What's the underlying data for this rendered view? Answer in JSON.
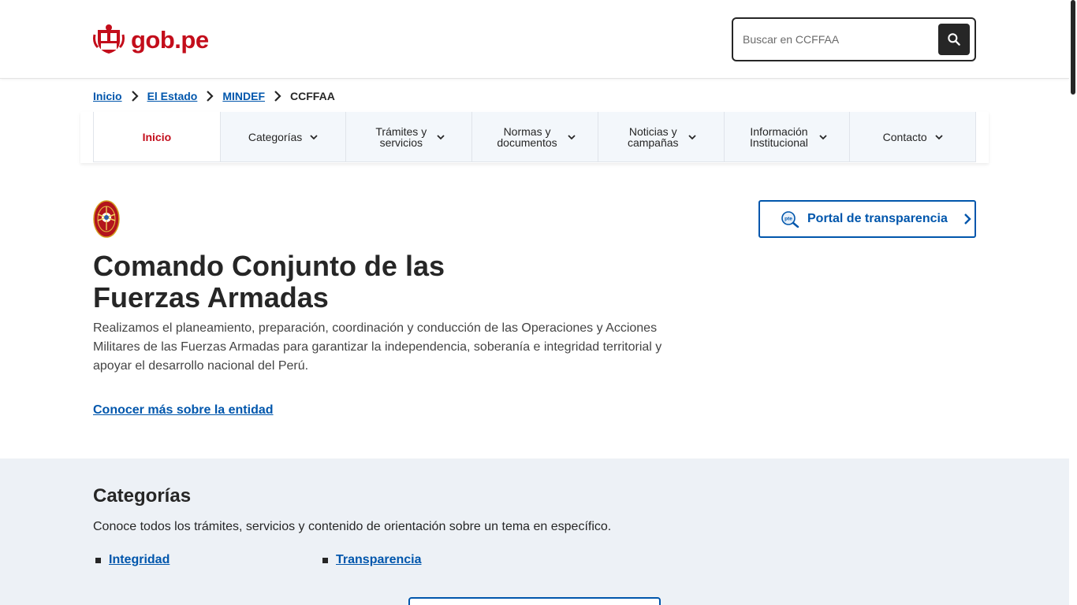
{
  "header": {
    "logo_text": "gob.pe",
    "search_placeholder": "Buscar en CCFFAA"
  },
  "breadcrumb": {
    "items": [
      "Inicio",
      "El Estado",
      "MINDEF"
    ],
    "current": "CCFFAA"
  },
  "nav": {
    "items": [
      {
        "label": "Inicio"
      },
      {
        "label": "Categorías"
      },
      {
        "label": "Trámites y servicios"
      },
      {
        "label": "Normas y documentos"
      },
      {
        "label": "Noticias y campañas"
      },
      {
        "label": "Información Institucional"
      },
      {
        "label": "Contacto"
      }
    ]
  },
  "hero": {
    "title": "Comando Conjunto de las Fuerzas Armadas",
    "description": "Realizamos el planeamiento, preparación, coordinación y conducción de las Operaciones y Acciones Militares de las Fuerzas Armadas para garantizar la independencia, soberanía e integridad territorial y apoyar el desarrollo nacional del Perú.",
    "more_link": "Conocer más sobre la entidad",
    "transparency_label": "Portal de transparencia"
  },
  "categories": {
    "title": "Categorías",
    "description": "Conoce todos los trámites, servicios y contenido de orientación sobre un tema en específico.",
    "items": [
      "Integridad",
      "Transparencia"
    ]
  },
  "colors": {
    "brand_red": "#c30d1b",
    "link_blue": "#0056ac",
    "dark": "#262626",
    "section_bg": "#edf1f6"
  }
}
